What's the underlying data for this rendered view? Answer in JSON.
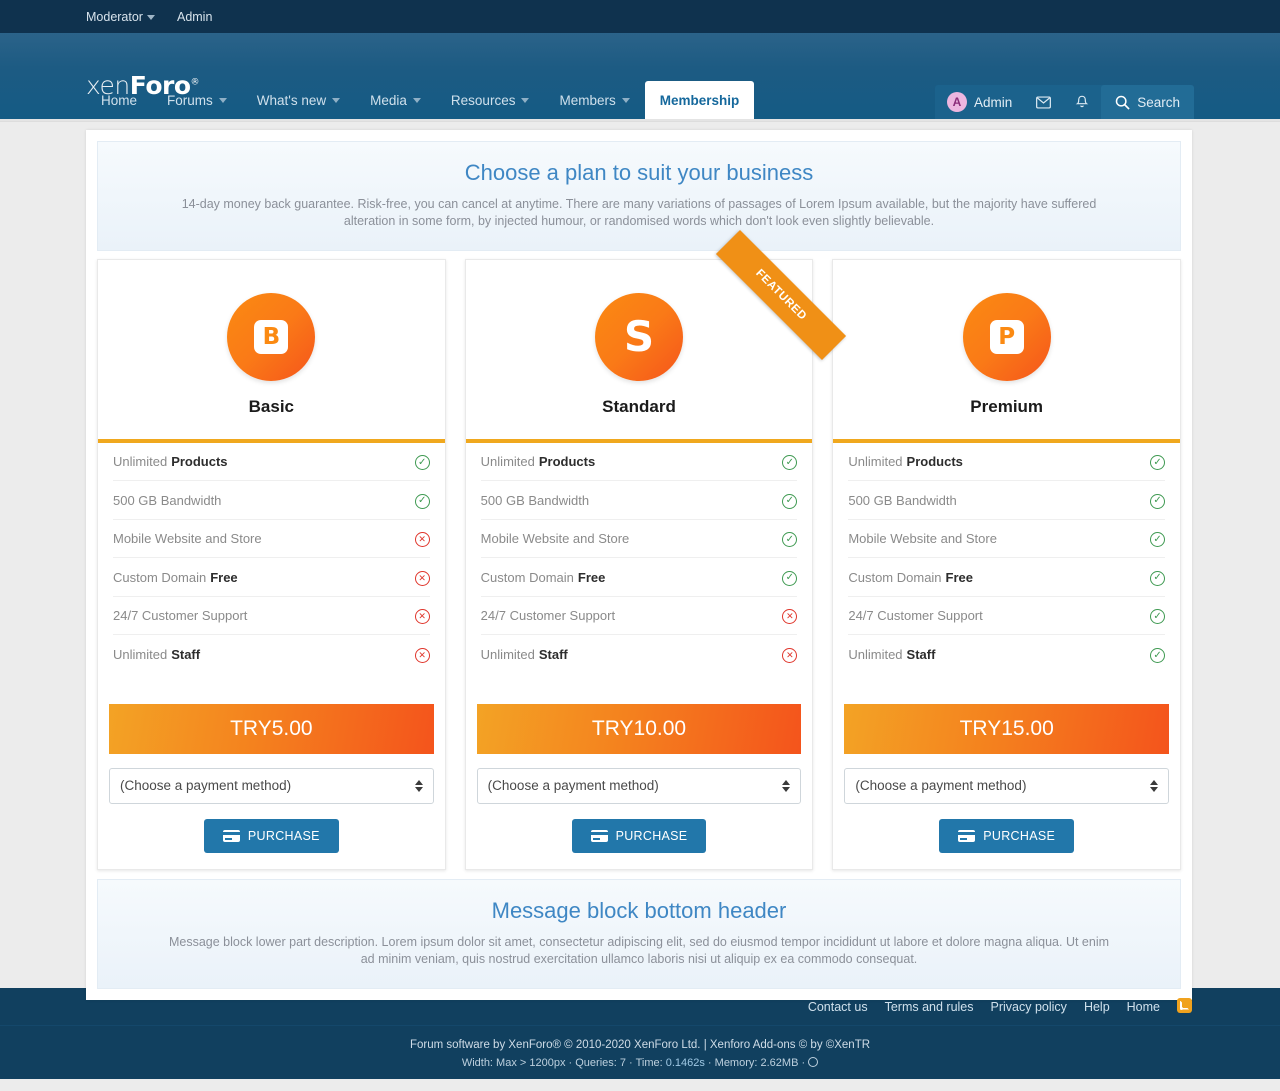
{
  "topbar": {
    "moderator": "Moderator",
    "admin": "Admin"
  },
  "header": {
    "logo_light": "xen",
    "logo_bold": "Foro",
    "logo_mark": "®",
    "nav": [
      {
        "label": "Home",
        "caret": false,
        "active": false
      },
      {
        "label": "Forums",
        "caret": true,
        "active": false
      },
      {
        "label": "What's new",
        "caret": true,
        "active": false
      },
      {
        "label": "Media",
        "caret": true,
        "active": false
      },
      {
        "label": "Resources",
        "caret": true,
        "active": false
      },
      {
        "label": "Members",
        "caret": true,
        "active": false
      },
      {
        "label": "Membership",
        "caret": false,
        "active": true
      }
    ],
    "user": {
      "initial": "A",
      "name": "Admin"
    },
    "search_label": "Search"
  },
  "top_message": {
    "title": "Choose a plan to suit your business",
    "description": "14-day money back guarantee. Risk-free, you can cancel at anytime. There are many variations of passages of Lorem Ipsum available, but the majority have suffered alteration in some form, by injected humour, or randomised words which don't look even slightly believable."
  },
  "plans": [
    {
      "name": "Basic",
      "icon_letter": "B",
      "icon_style": "boxed",
      "featured": false,
      "featured_label": "",
      "price": "TRY5.00",
      "payment_placeholder": "(Choose a payment method)",
      "purchase_label": "PURCHASE",
      "features": [
        {
          "text": "Unlimited ",
          "bold": "Products",
          "included": true
        },
        {
          "text": "500 GB Bandwidth",
          "bold": "",
          "included": true
        },
        {
          "text": "Mobile Website and Store",
          "bold": "",
          "included": false
        },
        {
          "text": "Custom Domain ",
          "bold": "Free",
          "included": false
        },
        {
          "text": "24/7 Customer Support",
          "bold": "",
          "included": false
        },
        {
          "text": "Unlimited ",
          "bold": "Staff",
          "included": false
        }
      ]
    },
    {
      "name": "Standard",
      "icon_letter": "S",
      "icon_style": "plain",
      "featured": true,
      "featured_label": "FEATURED",
      "price": "TRY10.00",
      "payment_placeholder": "(Choose a payment method)",
      "purchase_label": "PURCHASE",
      "features": [
        {
          "text": "Unlimited ",
          "bold": "Products",
          "included": true
        },
        {
          "text": "500 GB Bandwidth",
          "bold": "",
          "included": true
        },
        {
          "text": "Mobile Website and Store",
          "bold": "",
          "included": true
        },
        {
          "text": "Custom Domain ",
          "bold": "Free",
          "included": true
        },
        {
          "text": "24/7 Customer Support",
          "bold": "",
          "included": false
        },
        {
          "text": "Unlimited ",
          "bold": "Staff",
          "included": false
        }
      ]
    },
    {
      "name": "Premium",
      "icon_letter": "P",
      "icon_style": "boxed",
      "featured": false,
      "featured_label": "",
      "price": "TRY15.00",
      "payment_placeholder": "(Choose a payment method)",
      "purchase_label": "PURCHASE",
      "features": [
        {
          "text": "Unlimited ",
          "bold": "Products",
          "included": true
        },
        {
          "text": "500 GB Bandwidth",
          "bold": "",
          "included": true
        },
        {
          "text": "Mobile Website and Store",
          "bold": "",
          "included": true
        },
        {
          "text": "Custom Domain ",
          "bold": "Free",
          "included": true
        },
        {
          "text": "24/7 Customer Support",
          "bold": "",
          "included": true
        },
        {
          "text": "Unlimited ",
          "bold": "Staff",
          "included": true
        }
      ]
    }
  ],
  "bottom_message": {
    "title": "Message block bottom header",
    "description": "Message block lower part description. Lorem ipsum dolor sit amet, consectetur adipiscing elit, sed do eiusmod tempor incididunt ut labore et dolore magna aliqua. Ut enim ad minim veniam, quis nostrud exercitation ullamco laboris nisi ut aliquip ex ea commodo consequat."
  },
  "footer": {
    "links": [
      "Contact us",
      "Terms and rules",
      "Privacy policy",
      "Help",
      "Home"
    ],
    "copyright": "Forum software by XenForo® © 2010-2020 XenForo Ltd. | Xenforo Add-ons © by ©XenTR",
    "stats": {
      "width": "Width: Max > 1200px",
      "queries": "Queries: 7",
      "time_label": "Time: ",
      "time_value": "0.1462s",
      "memory": "Memory: 2.62MB",
      "sep": " · "
    }
  },
  "icons": {
    "yes": "✓",
    "no": "✕",
    "mail": "✉",
    "bell": "🔔",
    "search": "search-icon"
  }
}
